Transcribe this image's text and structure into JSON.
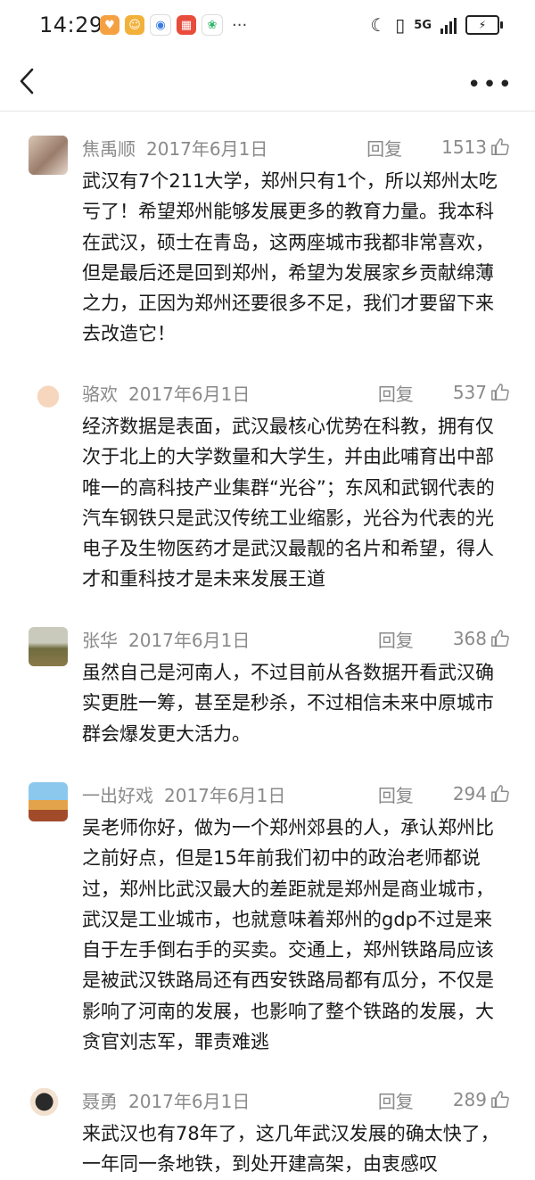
{
  "status_bar": {
    "time": "14:29",
    "network": "5G",
    "battery_icon": "battery-charging-icon"
  },
  "nav": {
    "back_icon": "chevron-left-icon",
    "more_icon": "more-dots-icon"
  },
  "reply_label": "回复",
  "comments": [
    {
      "user": "焦禹顺",
      "date": "2017年6月1日",
      "likes": "1513",
      "text": "武汉有7个211大学，郑州只有1个，所以郑州太吃亏了！希望郑州能够发展更多的教育力量。我本科在武汉，硕士在青岛，这两座城市我都非常喜欢，但是最后还是回到郑州，希望为发展家乡贡献绵薄之力，正因为郑州还要很多不足，我们才要留下来去改造它！"
    },
    {
      "user": "骆欢",
      "date": "2017年6月1日",
      "likes": "537",
      "text": "经济数据是表面，武汉最核心优势在科教，拥有仅次于北上的大学数量和大学生，并由此哺育出中部唯一的高科技产业集群“光谷”；东风和武钢代表的汽车钢铁只是武汉传统工业缩影，光谷为代表的光电子及生物医药才是武汉最靓的名片和希望，得人才和重科技才是未来发展王道"
    },
    {
      "user": "张华",
      "date": "2017年6月1日",
      "likes": "368",
      "text": "虽然自己是河南人，不过目前从各数据开看武汉确实更胜一筹，甚至是秒杀，不过相信未来中原城市群会爆发更大活力。"
    },
    {
      "user": "一出好戏",
      "date": "2017年6月1日",
      "likes": "294",
      "text": "吴老师你好，做为一个郑州郊县的人，承认郑州比之前好点，但是15年前我们初中的政治老师都说过，郑州比武汉最大的差距就是郑州是商业城市，武汉是工业城市，也就意味着郑州的gdp不过是来自于左手倒右手的买卖。交通上，郑州铁路局应该是被武汉铁路局还有西安铁路局都有瓜分，不仅是影响了河南的发展，也影响了整个铁路的发展，大贪官刘志军，罪责难逃"
    },
    {
      "user": "聂勇",
      "date": "2017年6月1日",
      "likes": "289",
      "text": "来武汉也有78年了，这几年武汉发展的确太快了，一年同一条地铁，到处开建高架，由衷感叹"
    }
  ]
}
